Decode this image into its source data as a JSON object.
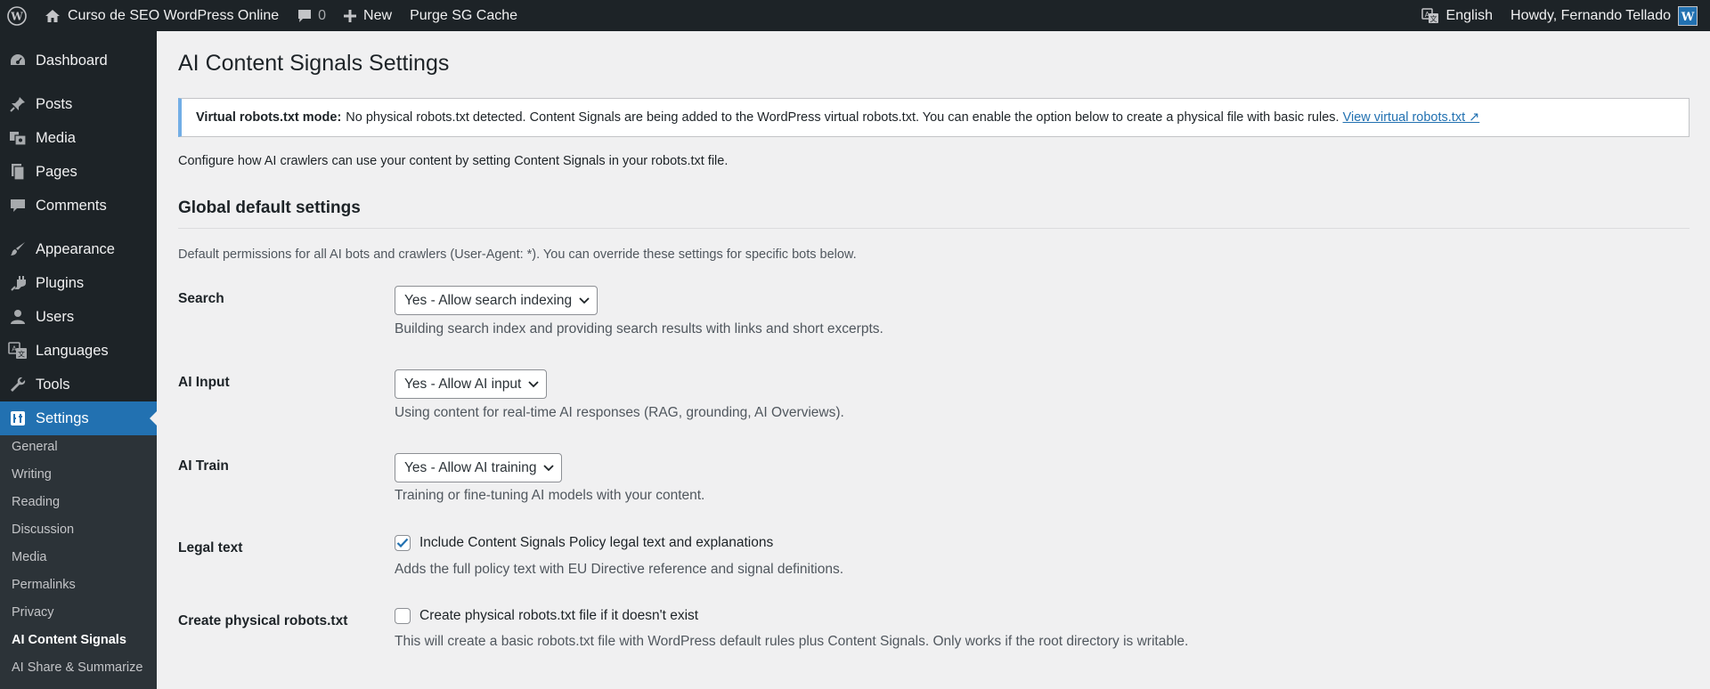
{
  "admin_bar": {
    "site_name": "Curso de SEO WordPress Online",
    "comments_count": "0",
    "new_label": "New",
    "purge_label": "Purge SG Cache",
    "language_label": "English",
    "howdy_label": "Howdy, Fernando Tellado"
  },
  "sidebar": {
    "items": [
      {
        "label": "Dashboard",
        "icon": "dashboard-icon"
      },
      {
        "label": "Posts",
        "icon": "pin-icon"
      },
      {
        "label": "Media",
        "icon": "media-icon"
      },
      {
        "label": "Pages",
        "icon": "pages-icon"
      },
      {
        "label": "Comments",
        "icon": "comments-icon"
      },
      {
        "label": "Appearance",
        "icon": "brush-icon"
      },
      {
        "label": "Plugins",
        "icon": "plugin-icon"
      },
      {
        "label": "Users",
        "icon": "users-icon"
      },
      {
        "label": "Languages",
        "icon": "translation-icon"
      },
      {
        "label": "Tools",
        "icon": "wrench-icon"
      },
      {
        "label": "Settings",
        "icon": "settings-icon"
      }
    ],
    "submenu": [
      "General",
      "Writing",
      "Reading",
      "Discussion",
      "Media",
      "Permalinks",
      "Privacy",
      "AI Content Signals",
      "AI Share & Summarize"
    ]
  },
  "page": {
    "title": "AI Content Signals Settings",
    "notice_bold": "Virtual robots.txt mode:",
    "notice_text": "No physical robots.txt detected. Content Signals are being added to the WordPress virtual robots.txt. You can enable the option below to create a physical file with basic rules.",
    "notice_link": "View virtual robots.txt ↗",
    "intro": "Configure how AI crawlers can use your content by setting Content Signals in your robots.txt file.",
    "section_title": "Global default settings",
    "section_desc": "Default permissions for all AI bots and crawlers (User-Agent: *). You can override these settings for specific bots below."
  },
  "fields": {
    "search": {
      "label": "Search",
      "value": "Yes - Allow search indexing",
      "desc": "Building search index and providing search results with links and short excerpts."
    },
    "ai_input": {
      "label": "AI Input",
      "value": "Yes - Allow AI input",
      "desc": "Using content for real-time AI responses (RAG, grounding, AI Overviews)."
    },
    "ai_train": {
      "label": "AI Train",
      "value": "Yes - Allow AI training",
      "desc": "Training or fine-tuning AI models with your content."
    },
    "legal": {
      "label": "Legal text",
      "checkbox_label": "Include Content Signals Policy legal text and explanations",
      "checked": true,
      "desc": "Adds the full policy text with EU Directive reference and signal definitions."
    },
    "physical": {
      "label": "Create physical robots.txt",
      "checkbox_label": "Create physical robots.txt file if it doesn't exist",
      "checked": false,
      "desc": "This will create a basic robots.txt file with WordPress default rules plus Content Signals. Only works if the root directory is writable."
    }
  },
  "colors": {
    "accent": "#2271b1",
    "admin_bar": "#1d2327",
    "notice_border": "#72aee6"
  }
}
